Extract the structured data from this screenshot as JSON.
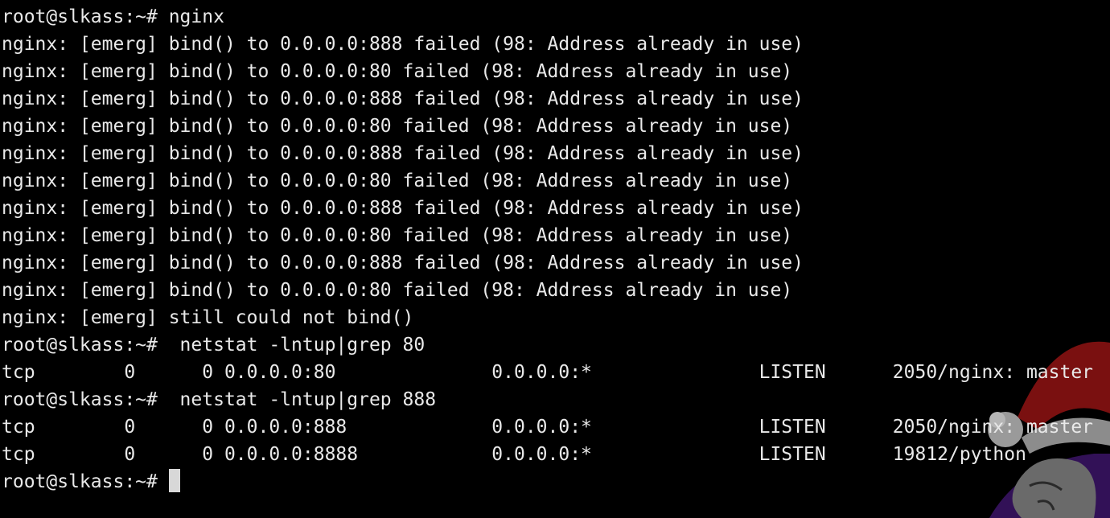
{
  "terminal": {
    "prompt": "root@slkass:~# ",
    "lines": [
      "root@slkass:~# nginx",
      "nginx: [emerg] bind() to 0.0.0.0:888 failed (98: Address already in use)",
      "nginx: [emerg] bind() to 0.0.0.0:80 failed (98: Address already in use)",
      "nginx: [emerg] bind() to 0.0.0.0:888 failed (98: Address already in use)",
      "nginx: [emerg] bind() to 0.0.0.0:80 failed (98: Address already in use)",
      "nginx: [emerg] bind() to 0.0.0.0:888 failed (98: Address already in use)",
      "nginx: [emerg] bind() to 0.0.0.0:80 failed (98: Address already in use)",
      "nginx: [emerg] bind() to 0.0.0.0:888 failed (98: Address already in use)",
      "nginx: [emerg] bind() to 0.0.0.0:80 failed (98: Address already in use)",
      "nginx: [emerg] bind() to 0.0.0.0:888 failed (98: Address already in use)",
      "nginx: [emerg] bind() to 0.0.0.0:80 failed (98: Address already in use)",
      "nginx: [emerg] still could not bind()",
      "root@slkass:~#  netstat -lntup|grep 80",
      "tcp        0      0 0.0.0.0:80              0.0.0.0:*               LISTEN      2050/nginx: master",
      "root@slkass:~#  netstat -lntup|grep 888",
      "tcp        0      0 0.0.0.0:888             0.0.0.0:*               LISTEN      2050/nginx: master",
      "tcp        0      0 0.0.0.0:8888            0.0.0.0:*               LISTEN      19812/python"
    ]
  },
  "colors": {
    "background": "#000000",
    "foreground": "#e9e9e9",
    "cursor": "#d8d8d8"
  },
  "decoration": {
    "icon": "santa-hat-mascot-icon"
  }
}
